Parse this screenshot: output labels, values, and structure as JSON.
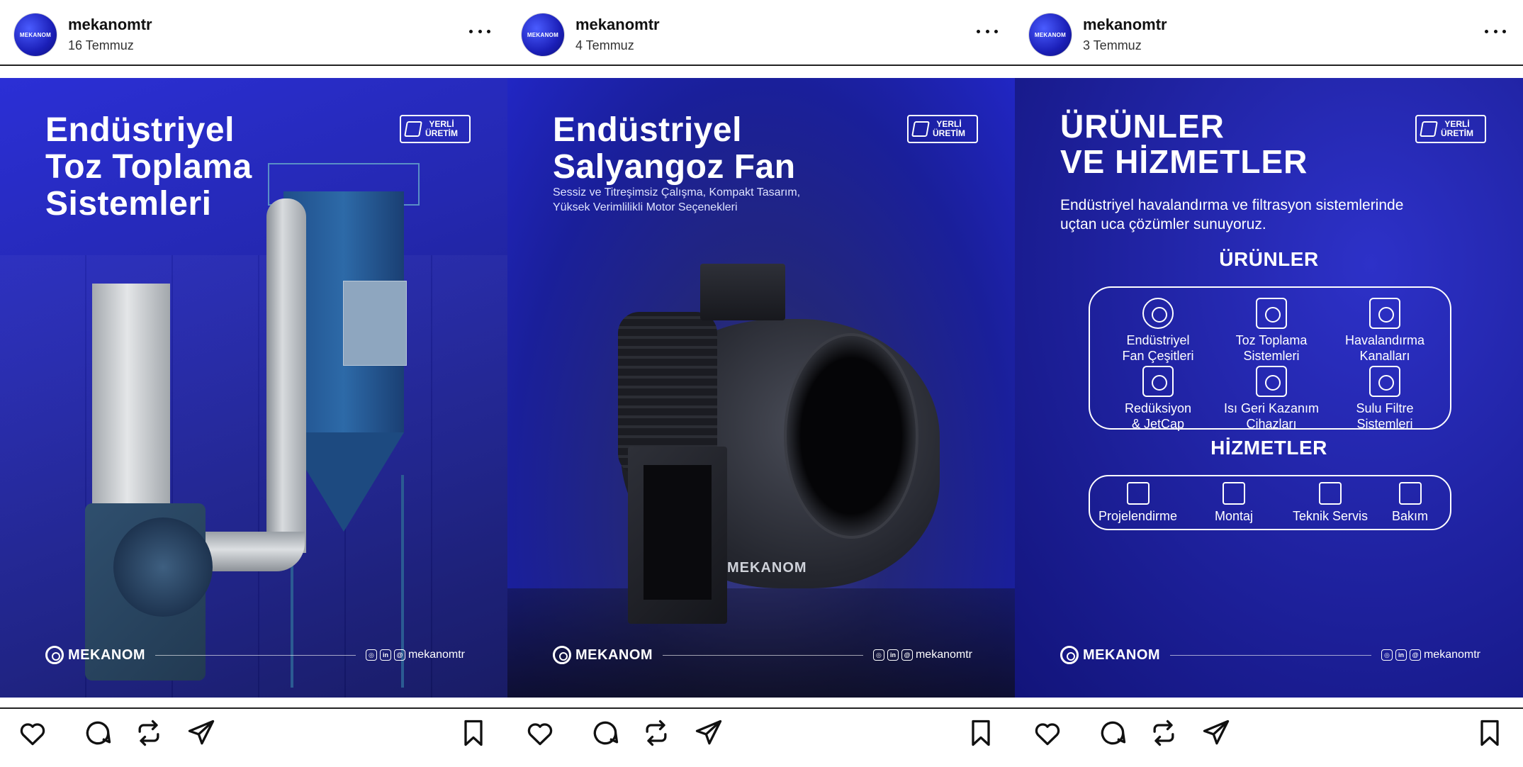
{
  "posts": [
    {
      "username": "mekanomtr",
      "date": "16 Temmuz",
      "headline": [
        "Endüstriyel",
        "Toz Toplama",
        "Sistemleri"
      ],
      "badge": [
        "YERLİ",
        "ÜRETİM"
      ],
      "brand": "MEKANOM",
      "social_handle": "mekanomtr"
    },
    {
      "username": "mekanomtr",
      "date": "4 Temmuz",
      "headline": [
        "Endüstriyel",
        "Salyangoz Fan"
      ],
      "subline": [
        "Sessiz ve Titreşimsiz Çalışma, Kompakt Tasarım,",
        "Yüksek Verimlilikli Motor Seçenekleri"
      ],
      "product_logo": "MEKANOM",
      "badge": [
        "YERLİ",
        "ÜRETİM"
      ],
      "brand": "MEKANOM",
      "social_handle": "mekanomtr"
    },
    {
      "username": "mekanomtr",
      "date": "3 Temmuz",
      "headline": [
        "ÜRÜNLER",
        "VE HİZMETLER"
      ],
      "subline": [
        "Endüstriyel havalandırma ve filtrasyon sistemlerinde",
        "uçtan uca çözümler sunuyoruz."
      ],
      "products_title": "ÜRÜNLER",
      "products": [
        {
          "label1": "Endüstriyel",
          "label2": "Fan Çeşitleri",
          "icon": "fan-icon"
        },
        {
          "label1": "Toz Toplama",
          "label2": "Sistemleri",
          "icon": "dust-collector-icon"
        },
        {
          "label1": "Havalandırma",
          "label2": "Kanalları",
          "icon": "duct-icon"
        },
        {
          "label1": "Redüksiyon",
          "label2": "& JetCap",
          "icon": "reduction-icon"
        },
        {
          "label1": "Isı Geri Kazanım",
          "label2": "Cihazları",
          "icon": "heat-recovery-icon"
        },
        {
          "label1": "Sulu Filtre",
          "label2": "Sistemleri",
          "icon": "wet-filter-icon"
        }
      ],
      "services_title": "HİZMETLER",
      "services": [
        {
          "label": "Projelendirme",
          "icon": "blueprint-icon"
        },
        {
          "label": "Montaj",
          "icon": "tools-icon"
        },
        {
          "label": "Teknik Servis",
          "icon": "headset-icon"
        },
        {
          "label": "Bakım",
          "icon": "checklist-icon"
        }
      ],
      "badge": [
        "YERLİ",
        "ÜRETİM"
      ],
      "brand": "MEKANOM",
      "social_handle": "mekanomtr"
    }
  ],
  "action_icons": [
    "heart-icon",
    "comment-icon",
    "repost-icon",
    "share-icon",
    "bookmark-icon"
  ],
  "colors": {
    "brand_blue": "#2428b0",
    "dark_blue": "#12147a",
    "text": "#111111"
  }
}
